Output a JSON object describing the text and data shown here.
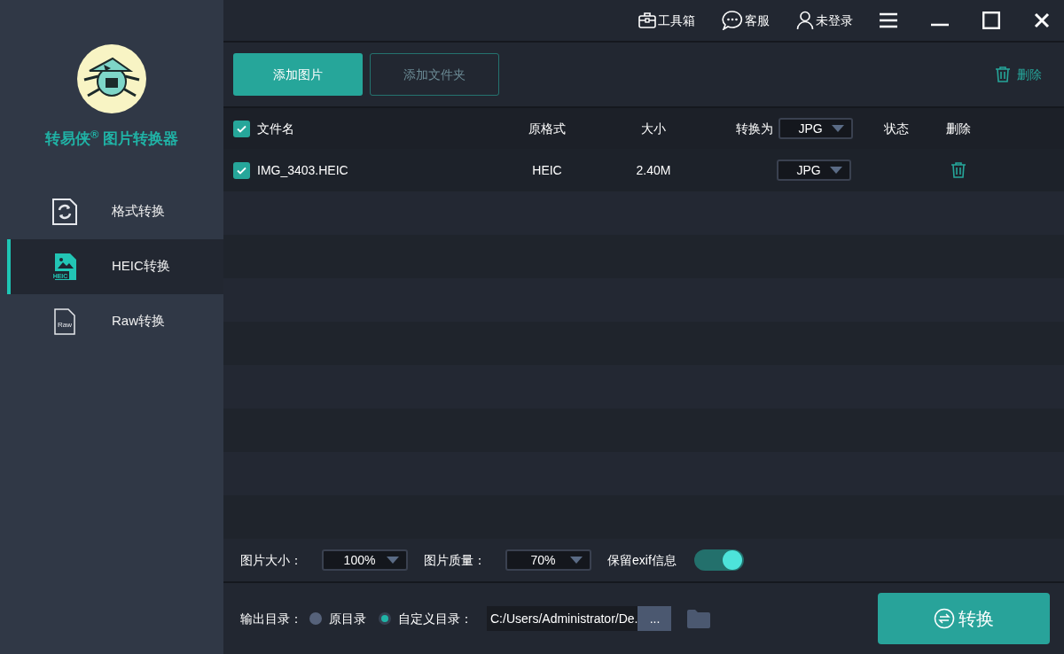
{
  "app": {
    "name": "转易侠$^{®}$ 图片转换器"
  },
  "sidebar": {
    "items": [
      {
        "label": "格式转换",
        "kind": "format",
        "selected": false
      },
      {
        "label": "HEIC转换",
        "kind": "heic",
        "icon_text": "HEIC",
        "selected": true
      },
      {
        "label": "Raw转换",
        "kind": "raw",
        "icon_text": "Raw",
        "selected": false
      }
    ]
  },
  "topbar": {
    "items": [
      {
        "label": "工具箱",
        "kind": "toolbox"
      },
      {
        "label": "客服",
        "kind": "chat"
      },
      {
        "label": "未登录",
        "kind": "user"
      }
    ]
  },
  "toolbar": {
    "buttons": [
      {
        "label": "添加图片",
        "kind": "primary"
      },
      {
        "label": "添加文件夹",
        "kind": "outline"
      }
    ],
    "delete": "删除"
  },
  "table": {
    "select_all": true,
    "columns": [
      "文件名",
      "原格式",
      "大小",
      "转换为",
      "状态",
      "删除"
    ],
    "convert_to": "JPG",
    "rows": [
      {
        "checked": true,
        "name": "IMG_3403.HEIC",
        "format": "HEIC",
        "size": "2.40M",
        "target": "JPG"
      }
    ]
  },
  "options": {
    "size_label": "图片大小：",
    "size": "100%",
    "quality_label": "图片质量：",
    "quality": "70%",
    "exif_label": "保留exif信息",
    "exif_on": true
  },
  "output": {
    "label": "输出目录：",
    "choices": [
      {
        "label": "原目录",
        "selected": false
      },
      {
        "label": "自定义目录：",
        "selected": true
      }
    ],
    "path": "C:/Users/Administrator/De.",
    "browse": "...",
    "convert": "转换"
  }
}
